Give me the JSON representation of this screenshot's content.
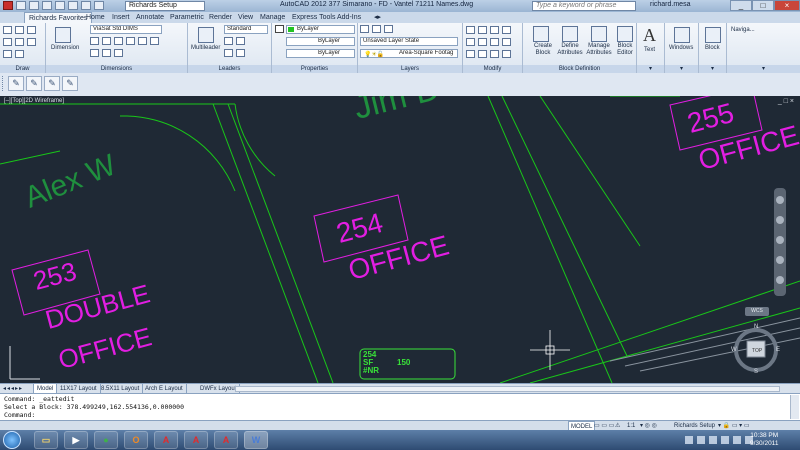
{
  "titlebar": {
    "workspace": "Richards Setup",
    "title": "AutoCAD 2012   377 Simarano - FD - Vantel 71211 Names.dwg",
    "search_placeholder": "Type a keyword or phrase",
    "user": "richard.mesa"
  },
  "ribbon_tabs": [
    "Richards Favorites",
    "Home",
    "Insert",
    "Annotate",
    "Parametric",
    "Render",
    "View",
    "Manage",
    "Express Tools",
    "Add-Ins"
  ],
  "panels": {
    "draw": "Draw",
    "dimensions": "Dimensions",
    "dimension_button": "Dimension",
    "dim_style": "ViaSat Std DIMS",
    "leaders": "Leaders",
    "multileader_button": "Multileader",
    "text_style": "Standard",
    "properties": "Properties",
    "bylayer_color": "ByLayer",
    "bylayer_linetype": "ByLayer",
    "bylayer_lineweight": "ByLayer",
    "layers": "Layers",
    "layer_state": "Unsaved Layer State",
    "current_layer": "Area-Square Footag",
    "modify": "Modify",
    "block_definition": "Block Definition",
    "create_block": "Create Block",
    "define_attributes": "Define Attributes",
    "manage_attributes": "Manage Attributes",
    "block_editor": "Block Editor",
    "text_button": "Text",
    "windows_button": "Windows",
    "block_button": "Block",
    "navigate": "Naviga..."
  },
  "canvas": {
    "viewport_label": "[–][Top][2D Wireframe]",
    "viewport_controls": "_ □ ×",
    "rooms": [
      {
        "name": "Alex W",
        "number": "253",
        "type_line1": "DOUBLE",
        "type_line2": "OFFICE"
      },
      {
        "name": "Jim D",
        "number": "254",
        "type_line1": "OFFICE"
      },
      {
        "number": "255",
        "type_line1": "OFFICE"
      }
    ],
    "area_tag": {
      "line1": "254",
      "line2": "SF",
      "line3": "#NR",
      "value": "150"
    },
    "wcs": "WCS",
    "viewcube": {
      "top": "TOP",
      "n": "N",
      "s": "S",
      "e": "E",
      "w": "W"
    },
    "colors": {
      "background": "#1f2935",
      "room_name": "#1f8f3e",
      "room_tag": "#e21ee2",
      "walls": "#19c619",
      "area_tag": "#39e239"
    }
  },
  "layout_tabs": [
    "Model",
    "11X17 Layout",
    "8.5X11 Layout",
    "Arch E Layout",
    "DWFx Layout"
  ],
  "command": {
    "line1": "Command:  _eattedit",
    "line2": "Select a Block: 378.499249,162.554136,0.000000",
    "line3": "Command:"
  },
  "status": {
    "model": "MODEL",
    "scale": "1:1",
    "workspace": "Richards Setup"
  },
  "taskbar": {
    "time": "10:38 PM",
    "date": "9/30/2011"
  }
}
